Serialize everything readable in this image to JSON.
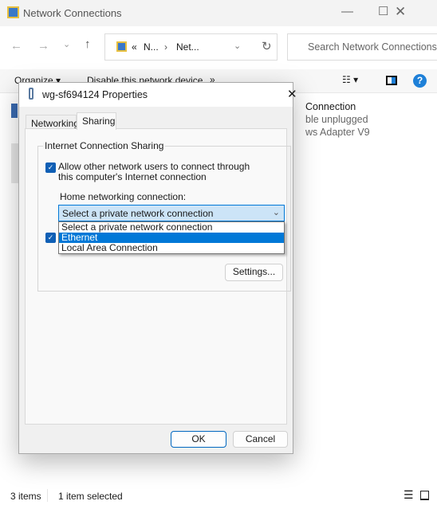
{
  "window": {
    "title": "Network Connections"
  },
  "nav": {
    "breadcrumb": [
      "N...",
      "Net..."
    ],
    "breadcrumb_prefix": "«",
    "search_placeholder": "Search Network Connections"
  },
  "toolbar": {
    "organize": "Organize",
    "disable": "Disable this network device",
    "more": "»"
  },
  "background_items": [
    "Connection",
    "ble unplugged",
    "ws Adapter V9"
  ],
  "dialog": {
    "title": "wg-sf694124 Properties",
    "tabs": [
      {
        "label": "Networking",
        "active": false
      },
      {
        "label": "Sharing",
        "active": true
      }
    ],
    "group_title": "Internet Connection Sharing",
    "allow_checkbox": {
      "label": "Allow other network users to connect through this computer's Internet connection",
      "checked": true
    },
    "second_checkbox": {
      "checked": true
    },
    "home_label": "Home networking connection:",
    "combo": {
      "value": "Select a private network connection",
      "options": [
        "Select a private network connection",
        "Ethernet",
        "Local Area Connection"
      ],
      "highlighted": "Ethernet"
    },
    "settings": "Settings...",
    "ok": "OK",
    "cancel": "Cancel"
  },
  "status": {
    "items": "3 items",
    "selected": "1 item selected"
  },
  "colors": {
    "accent": "#0078d7",
    "checkbox": "#0f5fb5"
  }
}
